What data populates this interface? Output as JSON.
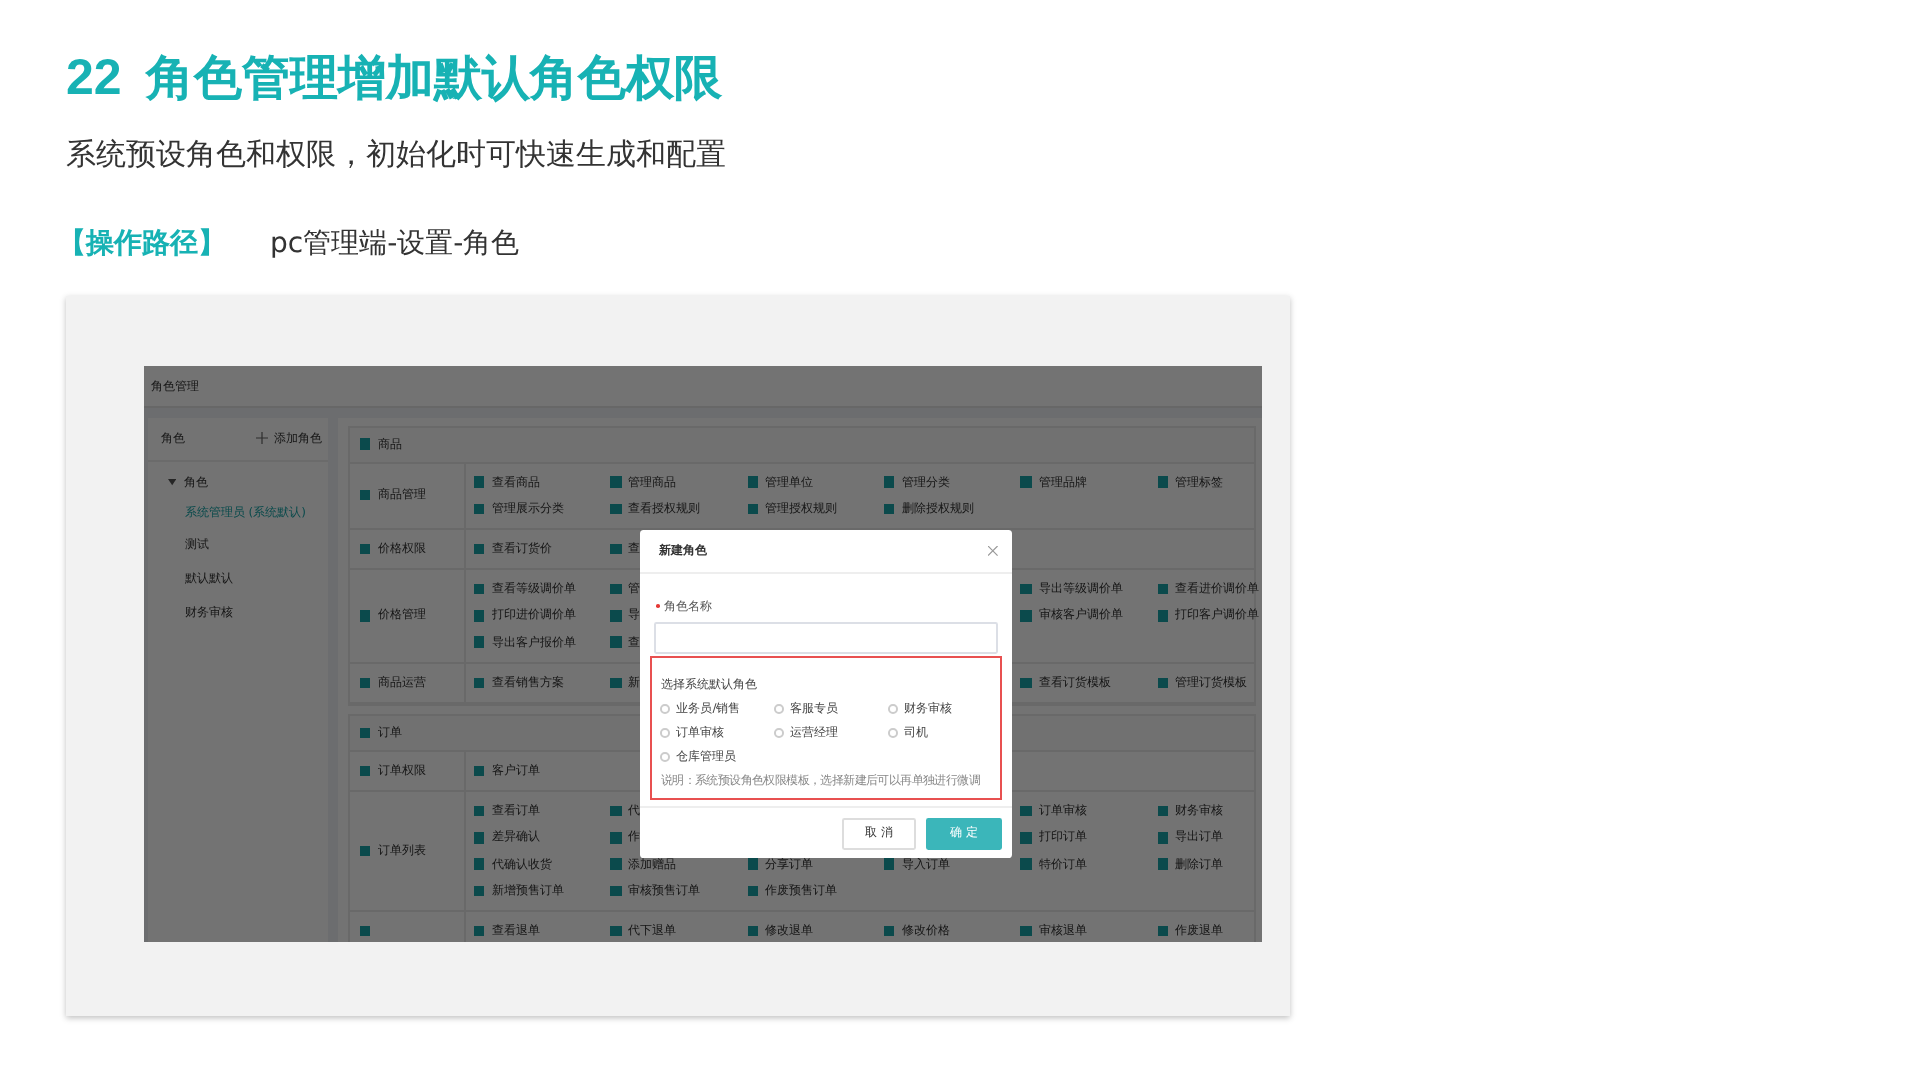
{
  "heading": {
    "number": "22",
    "title": "角色管理增加默认角色权限"
  },
  "subtitle": "系统预设角色和权限，初始化时可快速生成和配置",
  "path": {
    "label": "【操作路径】",
    "value": "pc管理端-设置-角色"
  },
  "screenshot": {
    "header_title": "角色管理",
    "sidebar": {
      "title": "角色",
      "add_button": "添加角色",
      "tree": [
        {
          "label": "角色",
          "expanded": true,
          "children": [
            {
              "label": "系统管理员 (系统默认)",
              "selected": true
            },
            {
              "label": "测试",
              "selected": false
            },
            {
              "label": "默认默认",
              "selected": false
            },
            {
              "label": "财务审核",
              "selected": false
            }
          ]
        }
      ]
    },
    "permissions": [
      {
        "name": "商品",
        "checked": true,
        "rows": [
          {
            "name": "商品管理",
            "checked": true,
            "lines": [
              {
                "left": [
                  {
                    "label": "查看商品",
                    "checked": true
                  },
                  {
                    "label": "管理商品",
                    "checked": true
                  },
                  {
                    "label": "管理单位",
                    "checked": true
                  },
                  {
                    "label": "管理分类",
                    "checked": true
                  },
                  {
                    "label": "管理品牌",
                    "checked": true
                  },
                  {
                    "label": "管理标签",
                    "checked": true
                  }
                ]
              },
              {
                "left": [
                  {
                    "label": "管理展示分类",
                    "checked": true
                  },
                  {
                    "label": "查看授权规则",
                    "checked": true
                  },
                  {
                    "label": "管理授权规则",
                    "checked": true
                  },
                  {
                    "label": "删除授权规则",
                    "checked": true
                  }
                ]
              }
            ]
          },
          {
            "name": "价格权限",
            "checked": true,
            "lines": [
              {
                "left": [
                  {
                    "label": "查看订货价",
                    "checked": true
                  },
                  {
                    "label": "查",
                    "checked": true
                  }
                ]
              }
            ]
          },
          {
            "name": "价格管理",
            "checked": true,
            "lines": [
              {
                "left": [
                  {
                    "label": "查看等级调价单",
                    "checked": true
                  },
                  {
                    "label": "管",
                    "checked": true
                  }
                ],
                "right": [
                  {
                    "label": "导出等级调价单",
                    "checked": true
                  },
                  {
                    "label": "查看进价调价单",
                    "checked": true
                  }
                ]
              },
              {
                "left": [
                  {
                    "label": "打印进价调价单",
                    "checked": true
                  },
                  {
                    "label": "导",
                    "checked": true
                  }
                ],
                "right": [
                  {
                    "label": "审核客户调价单",
                    "checked": true
                  },
                  {
                    "label": "打印客户调价单",
                    "checked": true
                  }
                ]
              },
              {
                "left": [
                  {
                    "label": "导出客户报价单",
                    "checked": true
                  },
                  {
                    "label": "查",
                    "checked": true
                  }
                ]
              }
            ]
          },
          {
            "name": "商品运营",
            "checked": true,
            "lines": [
              {
                "left": [
                  {
                    "label": "查看销售方案",
                    "checked": true
                  },
                  {
                    "label": "新",
                    "checked": true
                  }
                ],
                "right": [
                  {
                    "label": "查看订货模板",
                    "checked": true
                  },
                  {
                    "label": "管理订货模板",
                    "checked": true
                  }
                ]
              }
            ]
          }
        ]
      },
      {
        "name": "订单",
        "checked": true,
        "rows": [
          {
            "name": "订单权限",
            "checked": true,
            "lines": [
              {
                "left": [
                  {
                    "label": "客户订单",
                    "checked": true
                  }
                ]
              }
            ]
          },
          {
            "name": "订单列表",
            "checked": true,
            "lines": [
              {
                "left": [
                  {
                    "label": "查看订单",
                    "checked": true
                  },
                  {
                    "label": "代",
                    "checked": true
                  }
                ],
                "right": [
                  {
                    "label": "订单审核",
                    "checked": true
                  },
                  {
                    "label": "财务审核",
                    "checked": true
                  }
                ]
              },
              {
                "left": [
                  {
                    "label": "差异确认",
                    "checked": true
                  },
                  {
                    "label": "作",
                    "checked": true
                  }
                ],
                "right": [
                  {
                    "label": "打印订单",
                    "checked": true
                  },
                  {
                    "label": "导出订单",
                    "checked": true
                  }
                ]
              },
              {
                "left": [
                  {
                    "label": "代确认收货",
                    "checked": true
                  },
                  {
                    "label": "添加赠品",
                    "checked": true
                  },
                  {
                    "label": "分享订单",
                    "checked": true
                  },
                  {
                    "label": "导入订单",
                    "checked": true
                  },
                  {
                    "label": "特价订单",
                    "checked": true
                  },
                  {
                    "label": "删除订单",
                    "checked": true
                  }
                ]
              },
              {
                "left": [
                  {
                    "label": "新增预售订单",
                    "checked": true
                  },
                  {
                    "label": "审核预售订单",
                    "checked": true
                  },
                  {
                    "label": "作废预售订单",
                    "checked": true
                  }
                ]
              }
            ]
          },
          {
            "checked": true,
            "lines": [
              {
                "left": [
                  {
                    "label": "查看退单",
                    "checked": true
                  },
                  {
                    "label": "代下退单",
                    "checked": true
                  },
                  {
                    "label": "修改退单",
                    "checked": true
                  },
                  {
                    "label": "修改价格",
                    "checked": true
                  },
                  {
                    "label": "审核退单",
                    "checked": true
                  },
                  {
                    "label": "作废退单",
                    "checked": true
                  }
                ]
              }
            ]
          }
        ]
      }
    ],
    "modal": {
      "title": "新建角色",
      "name_label": "角色名称",
      "required": true,
      "default_roles": {
        "title": "选择系统默认角色",
        "options": [
          {
            "label": "业务员/销售",
            "selected": false
          },
          {
            "label": "客服专员",
            "selected": false
          },
          {
            "label": "财务审核",
            "selected": false
          },
          {
            "label": "订单审核",
            "selected": false
          },
          {
            "label": "运营经理",
            "selected": false
          },
          {
            "label": "司机",
            "selected": false
          },
          {
            "label": "仓库管理员",
            "selected": false
          }
        ],
        "note": "说明：系统预设角色权限模板，选择新建后可以再单独进行微调"
      },
      "buttons": [
        {
          "label": "取 消",
          "kind": "secondary"
        },
        {
          "label": "确 定",
          "kind": "primary"
        }
      ]
    }
  }
}
